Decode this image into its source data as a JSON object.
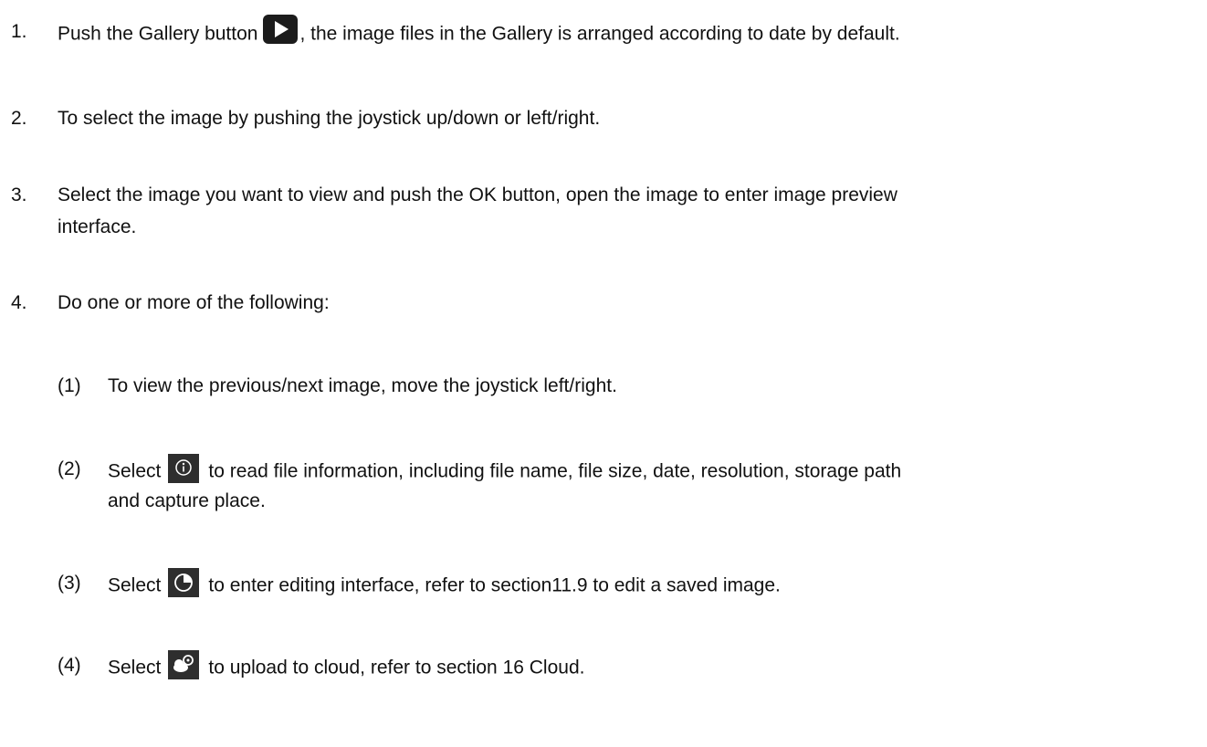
{
  "steps": [
    {
      "num": "1.",
      "before": "Push the Gallery button",
      "icon": "play-icon",
      "after": ", the image files in the Gallery is arranged according to date by default."
    },
    {
      "num": "2.",
      "text": "To select the image by pushing the joystick up/down or left/right."
    },
    {
      "num": "3.",
      "line1": "Select the image you want to view and push the OK button, open the image to enter image preview",
      "line2": "interface."
    },
    {
      "num": "4.",
      "text": "Do one or more of the following:"
    }
  ],
  "substeps": [
    {
      "num": "(1)",
      "text": "To view the previous/next image, move the joystick left/right."
    },
    {
      "num": "(2)",
      "before": "Select",
      "icon": "info-icon",
      "line1": "to read file information, including file name, file size, date, resolution, storage path",
      "line2": "and capture place."
    },
    {
      "num": "(3)",
      "before": "Select",
      "icon": "edit-pie-icon",
      "after": "to enter editing interface, refer to section11.9 to edit a saved image."
    },
    {
      "num": "(4)",
      "before": "Select",
      "icon": "cloud-upload-icon",
      "after": "to upload to cloud, refer to section 16 Cloud."
    }
  ],
  "colors": {
    "text": "#111111",
    "icon_bg": "#2e2e2e",
    "icon_fg": "#ffffff"
  }
}
